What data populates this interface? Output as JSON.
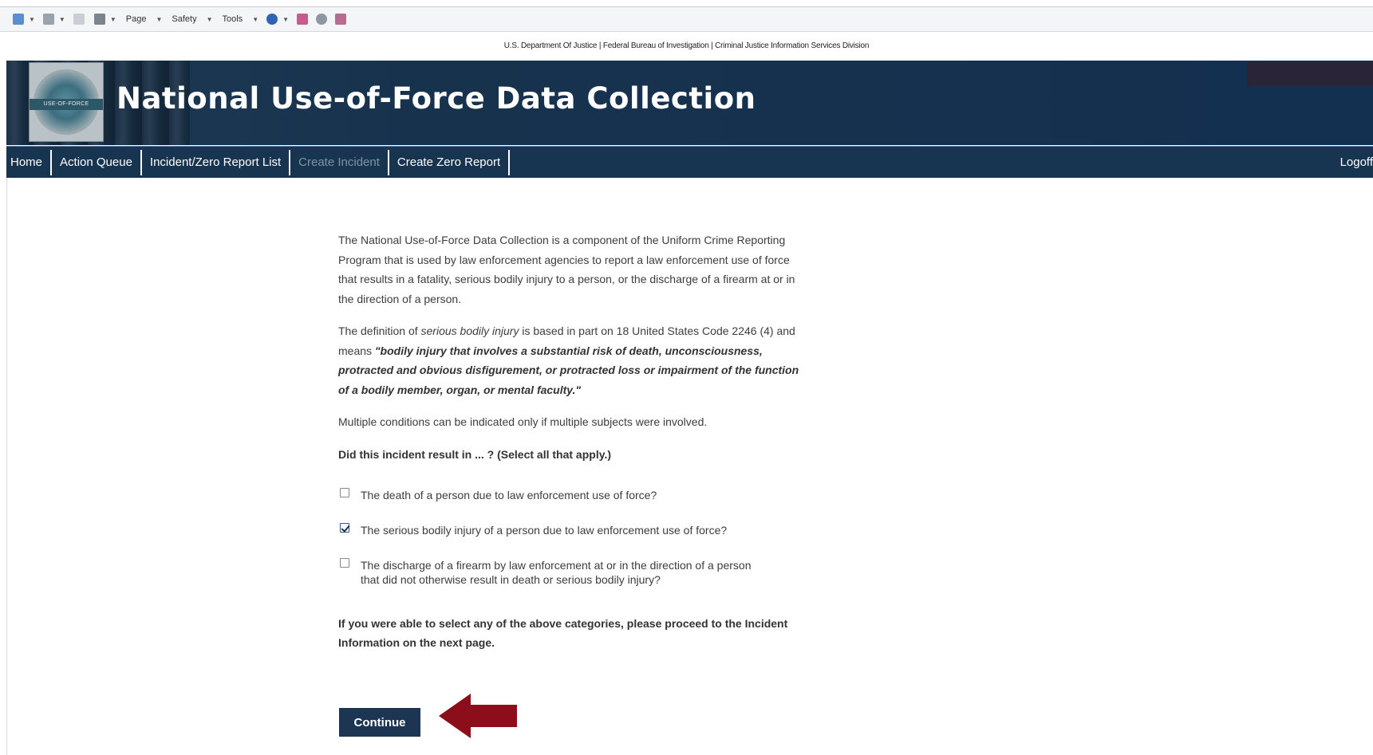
{
  "toolbar": {
    "menus": [
      "Page",
      "Safety",
      "Tools"
    ]
  },
  "header": {
    "agency_line": "U.S. Department Of Justice | Federal Bureau of Investigation | Criminal Justice Information Services Division",
    "seal_text": "USE-OF-FORCE",
    "title": "National Use-of-Force Data Collection"
  },
  "nav": {
    "items": [
      {
        "label": "Home",
        "enabled": true
      },
      {
        "label": "Action Queue",
        "enabled": true
      },
      {
        "label": "Incident/Zero Report List",
        "enabled": true
      },
      {
        "label": "Create Incident",
        "enabled": false
      },
      {
        "label": "Create Zero Report",
        "enabled": true
      }
    ],
    "logoff": "Logoff"
  },
  "content": {
    "intro": "The National Use-of-Force Data Collection is a component of the Uniform Crime Reporting Program that is used by law enforcement agencies to report a law enforcement use of force that results in a fatality, serious bodily injury to a person, or the discharge of a firearm at or in the direction of a person.",
    "definition_prefix": "The definition of ",
    "definition_term": "serious bodily injury",
    "definition_middle": " is based in part on 18 United States Code 2246 (4) and means ",
    "definition_quote": "\"bodily injury that involves a substantial risk of death, unconsciousness, protracted and obvious disfigurement, or protracted loss or impairment of the function of a bodily member, organ, or mental faculty.\"",
    "multiple_note": "Multiple conditions can be indicated only if multiple subjects were involved.",
    "question": "Did this incident result in ... ? (Select all that apply.)",
    "options": [
      {
        "label": "The death of a person due to law enforcement use of force?",
        "checked": false
      },
      {
        "label": "The serious bodily injury of a person due to law enforcement use of force?",
        "checked": true
      },
      {
        "label": "The discharge of a firearm by law enforcement at or in the direction of a person that did not otherwise result in death or serious bodily injury?",
        "checked": false
      }
    ],
    "proceed": "If you were able to select any of the above categories, please proceed to the Incident Information on the next page.",
    "continue_label": "Continue"
  },
  "colors": {
    "banner": "#17324d",
    "nav": "#173450",
    "button": "#1b3552",
    "arrow": "#8b0e1a"
  }
}
